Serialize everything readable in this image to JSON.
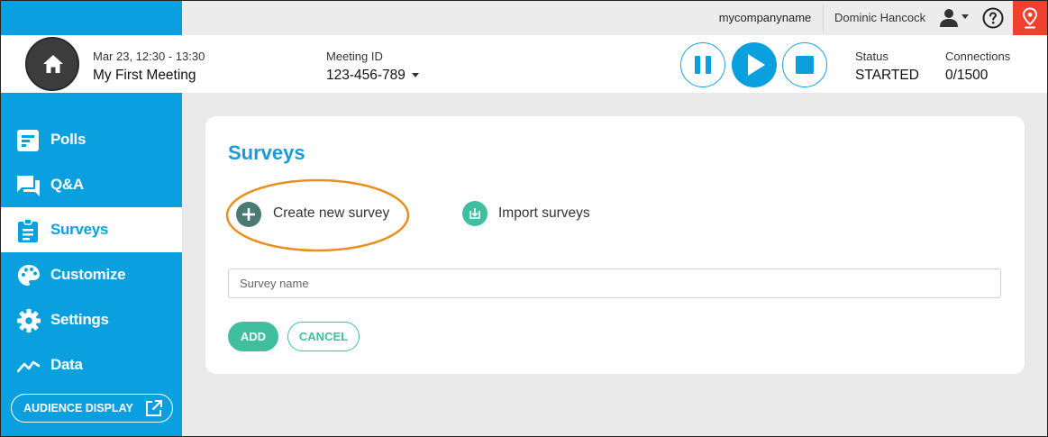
{
  "topbar": {
    "company": "mycompanyname",
    "user_name": "Dominic Hancock",
    "icons": [
      "user-icon",
      "help-icon",
      "location-pin-icon"
    ]
  },
  "header": {
    "date_range": "Mar 23, 12:30 - 13:30",
    "meeting_title": "My First Meeting",
    "meeting_id_label": "Meeting ID",
    "meeting_id": "123-456-789",
    "status_label": "Status",
    "status_value": "STARTED",
    "connections_label": "Connections",
    "connections_value": "0/1500",
    "controls": [
      "pause-icon",
      "play-icon",
      "stop-icon"
    ]
  },
  "sidebar": {
    "items": [
      {
        "label": "Polls",
        "icon": "polls-icon"
      },
      {
        "label": "Q&A",
        "icon": "chat-icon"
      },
      {
        "label": "Surveys",
        "icon": "clipboard-icon",
        "active": true
      },
      {
        "label": "Customize",
        "icon": "palette-icon"
      },
      {
        "label": "Settings",
        "icon": "gear-icon"
      },
      {
        "label": "Data",
        "icon": "trend-line-icon"
      }
    ],
    "audience_display": "AUDIENCE DISPLAY"
  },
  "main": {
    "title": "Surveys",
    "create_label": "Create new survey",
    "import_label": "Import surveys",
    "survey_name_placeholder": "Survey name",
    "add_label": "ADD",
    "cancel_label": "CANCEL"
  },
  "colors": {
    "brand_blue": "#0aa0e0",
    "title_blue": "#1b9ad6",
    "accent_teal": "#3fbfa0",
    "highlight_orange": "#e8901c",
    "alert_red": "#f0412e"
  }
}
